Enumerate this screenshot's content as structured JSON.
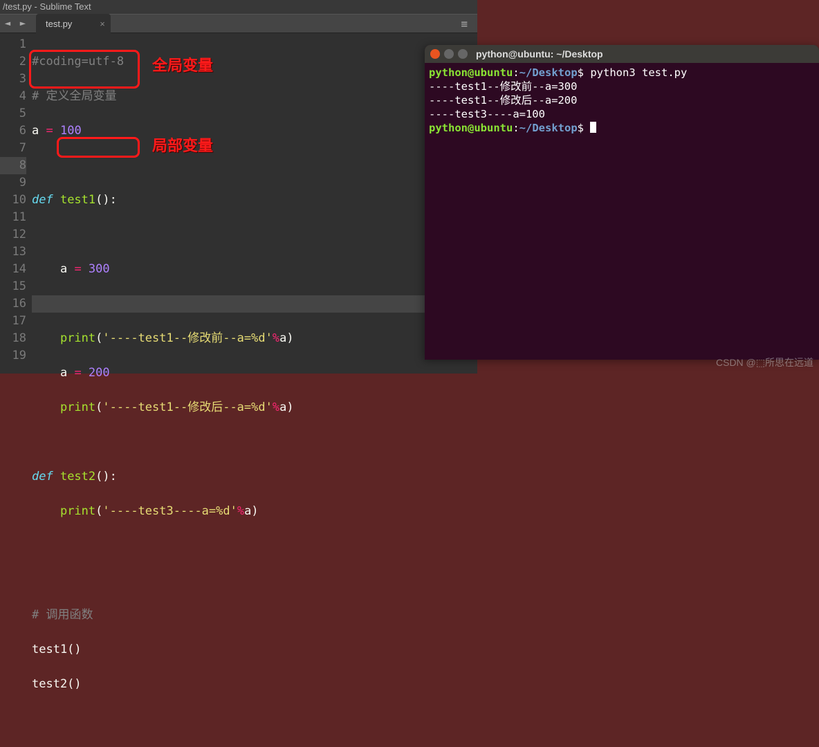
{
  "sublime": {
    "title": "/test.py - Sublime Text",
    "tab": "test.py",
    "close": "×",
    "menu_icon": "≡",
    "arrow_left": "◄",
    "arrow_right": "►",
    "gutter_lines": [
      "1",
      "2",
      "3",
      "4",
      "5",
      "6",
      "7",
      "8",
      "9",
      "10",
      "11",
      "12",
      "13",
      "14",
      "15",
      "16",
      "17",
      "18",
      "19"
    ],
    "code": {
      "l1": "#coding=utf-8",
      "l2_hash": "# ",
      "l2_cn": "定义全局变量",
      "l3_a": "a",
      "l3_eq": " = ",
      "l3_100": "100",
      "l5_def": "def ",
      "l5_name": "test1",
      "l5_paren": "():",
      "l7_a": "a",
      "l7_eq": " = ",
      "l7_300": "300",
      "l9_print": "print",
      "l9_p1": "(",
      "l9_s": "'----test1--修改前--a=%d'",
      "l9_pct": "%",
      "l9_a": "a",
      "l9_p2": ")",
      "l10_a": "a",
      "l10_eq": " = ",
      "l10_200": "200",
      "l11_print": "print",
      "l11_p1": "(",
      "l11_s": "'----test1--修改后--a=%d'",
      "l11_pct": "%",
      "l11_a": "a",
      "l11_p2": ")",
      "l13_def": "def ",
      "l13_name": "test2",
      "l13_paren": "():",
      "l14_print": "print",
      "l14_p1": "(",
      "l14_s": "'----test3----a=%d'",
      "l14_pct": "%",
      "l14_a": "a",
      "l14_p2": ")",
      "l17_hash": "# ",
      "l17_cn": "调用函数",
      "l18": "test1()",
      "l19": "test2()"
    },
    "anno": {
      "label1": "全局变量",
      "label2": "局部变量"
    }
  },
  "term": {
    "title": "python@ubuntu: ~/Desktop",
    "prompt_user": "python@ubuntu",
    "prompt_sep": ":",
    "prompt_path": "~/Desktop",
    "prompt_dollar": "$ ",
    "cmd1": "python3 test.py",
    "out1": "----test1--修改前--a=300",
    "out2": "----test1--修改后--a=200",
    "out3": "----test3----a=100"
  },
  "watermark": "CSDN @⬚所思在远道"
}
